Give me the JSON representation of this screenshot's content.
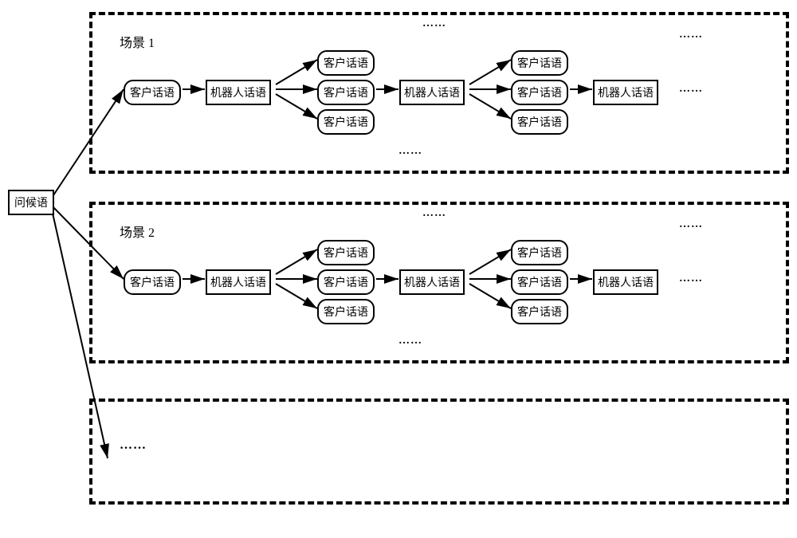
{
  "greeting": "问候语",
  "customer": "客户话语",
  "robot": "机器人话语",
  "scene1": "场景 1",
  "scene2": "场景 2",
  "dots": "……"
}
